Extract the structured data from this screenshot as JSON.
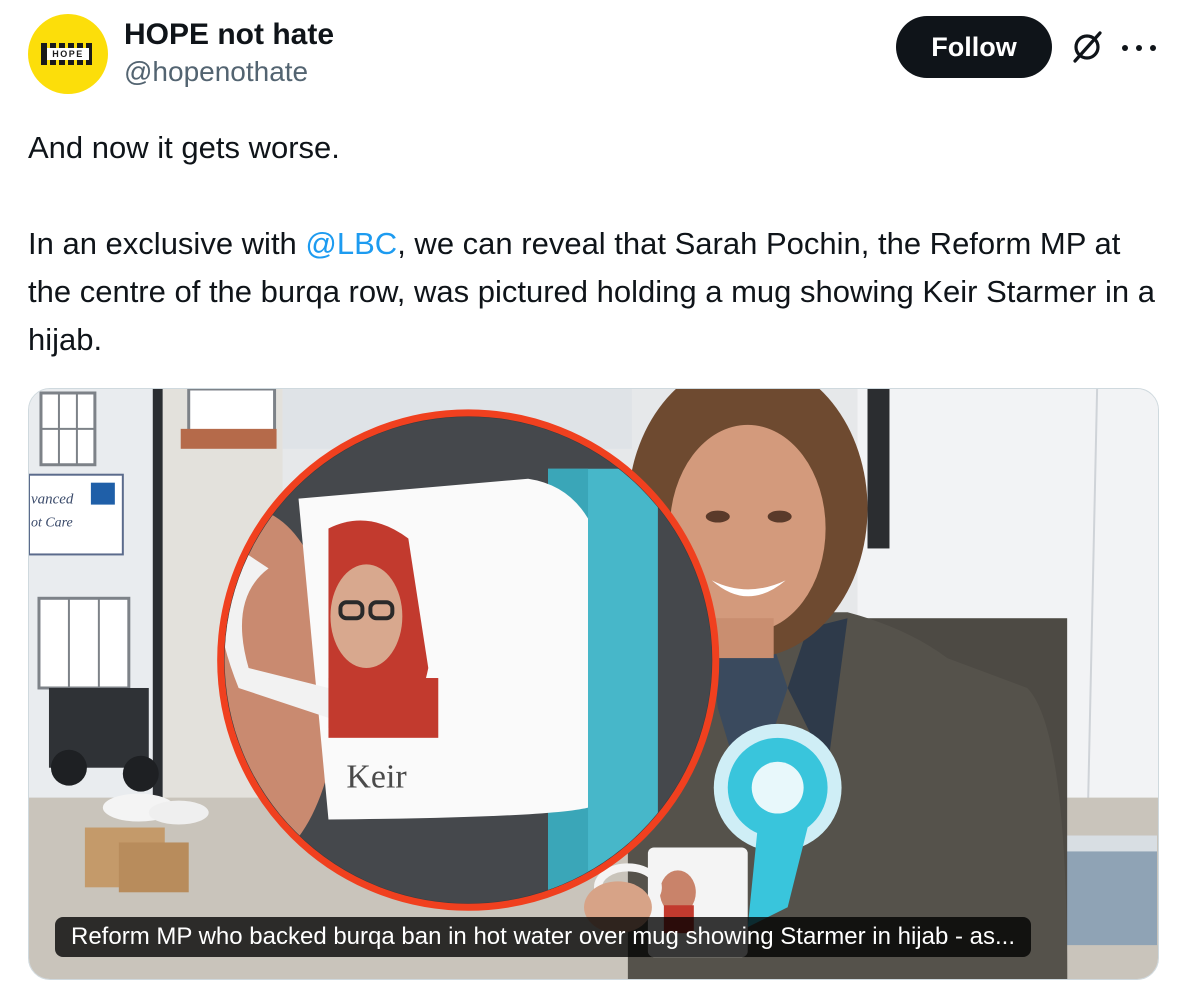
{
  "author": {
    "display_name": "HOPE not hate",
    "handle": "@hopenothate",
    "avatar_text": "HOPE",
    "avatar_color": "#fcde0a"
  },
  "actions": {
    "follow_label": "Follow",
    "grok_icon": "grok-icon",
    "more_icon": "more-icon"
  },
  "tweet": {
    "line1": "And now it gets worse.",
    "para2_before": "In an exclusive with ",
    "mention": "@LBC",
    "para2_after": ", we can reveal that Sarah Pochin, the Reform MP at the centre of the burqa row, was pictured holding a mug showing Keir Starmer in a hijab."
  },
  "media": {
    "caption": "Reform MP who backed burqa ban in hot water over mug showing Starmer in hijab - as...",
    "image_text": {
      "sign_line1": "vanced",
      "sign_line2": "ot Care",
      "mug_label": "Keir"
    }
  },
  "colors": {
    "link": "#1d9bf0",
    "text": "#0f1419",
    "secondary": "#536471",
    "highlight_circle": "#f0401f",
    "rosette": "#39c5dc"
  }
}
